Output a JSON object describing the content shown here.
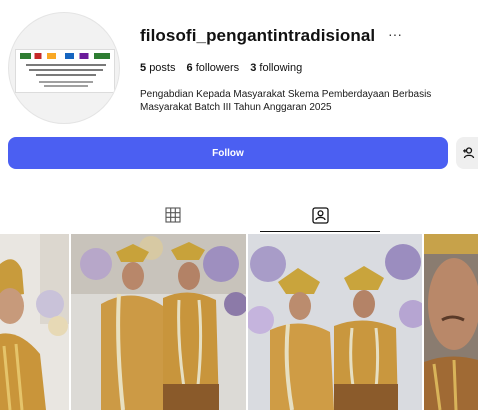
{
  "profile": {
    "username": "filosofi_pengantintradisional",
    "more_icon": "ellipsis-icon",
    "stats": {
      "posts_count": "5",
      "posts_label": "posts",
      "followers_count": "6",
      "followers_label": "followers",
      "following_count": "3",
      "following_label": "following"
    },
    "bio": "Pengabdian Kepada Masyarakat Skema Pemberdayaan Berbasis Masyarakat Batch III Tahun Anggaran 2025"
  },
  "actions": {
    "follow_label": "Follow",
    "suggest_icon": "add-person-icon"
  },
  "tabs": [
    {
      "name": "posts",
      "icon": "grid-icon",
      "active": false
    },
    {
      "name": "tagged",
      "icon": "tagged-person-icon",
      "active": true
    }
  ],
  "colors": {
    "follow_button": "#4b5ff2",
    "follow_text": "#ffffff",
    "secondary_button": "#efefef",
    "text": "#111111"
  }
}
